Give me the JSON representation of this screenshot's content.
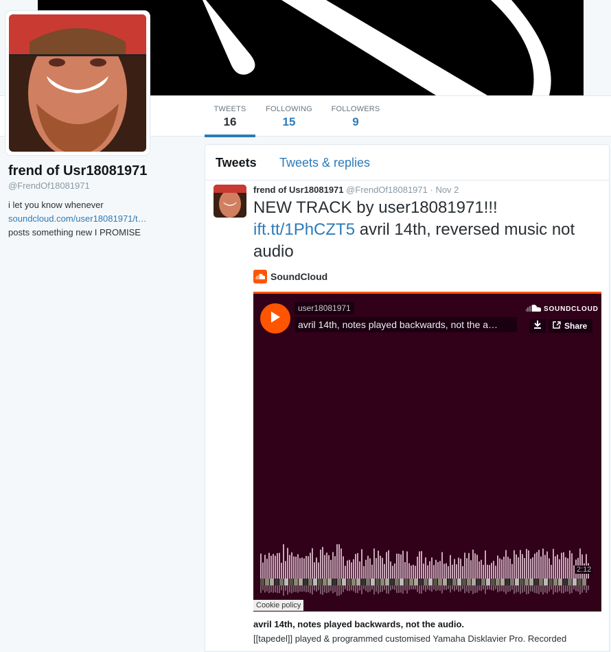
{
  "colors": {
    "link": "#2b7bb9",
    "soundcloud": "#ff5500",
    "player_bg": "#310019"
  },
  "nav": {
    "stats": [
      {
        "label": "TWEETS",
        "value": "16"
      },
      {
        "label": "FOLLOWING",
        "value": "15"
      },
      {
        "label": "FOLLOWERS",
        "value": "9"
      }
    ]
  },
  "profile": {
    "name": "frend of Usr18081971",
    "handle": "@FrendOf18081971",
    "bio_line1": "i let you know whenever",
    "bio_link": "soundcloud.com/user18081971/t…",
    "bio_line3": "posts something new I PROMISE"
  },
  "tabs": [
    {
      "label": "Tweets"
    },
    {
      "label": "Tweets & replies"
    }
  ],
  "tweet": {
    "name": "frend of Usr18081971",
    "handle": "@FrendOf18081971",
    "time": "· Nov 2",
    "text_line1": "NEW TRACK by user18081971!!!",
    "link": "ift.tt/1PhCZT5",
    "text_rest": " avril 14th, reversed music not audio",
    "card_source": "SoundCloud",
    "player": {
      "user": "user18081971",
      "track": "avril 14th, notes played backwards, not the a…",
      "brand": "SOUNDCLOUD",
      "share_label": "Share",
      "duration": "2:12",
      "cookie_label": "Cookie policy"
    },
    "desc_title": "avril 14th, notes played backwards, not the audio.",
    "desc_body": "[[tapedel]] played & programmed customised Yamaha Disklavier Pro. Recorded"
  }
}
